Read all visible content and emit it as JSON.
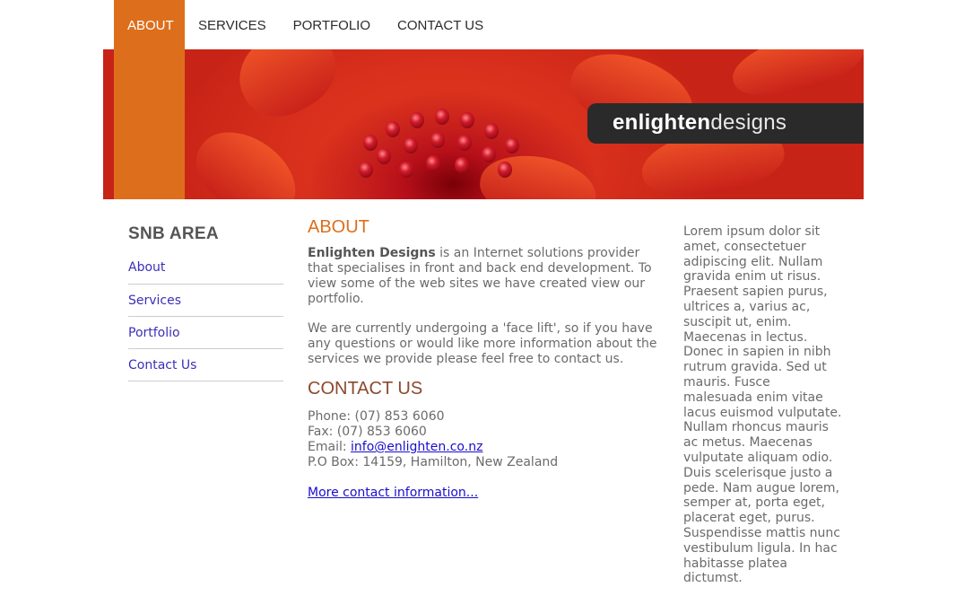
{
  "nav": {
    "items": [
      {
        "label": "ABOUT"
      },
      {
        "label": "SERVICES"
      },
      {
        "label": "PORTFOLIO"
      },
      {
        "label": "CONTACT US"
      }
    ]
  },
  "banner": {
    "logo_bold": "enlighten",
    "logo_light": "designs"
  },
  "sidebar": {
    "title": "SNB AREA",
    "items": [
      {
        "label": "About"
      },
      {
        "label": "Services"
      },
      {
        "label": "Portfolio"
      },
      {
        "label": "Contact Us"
      }
    ]
  },
  "main": {
    "about_heading": "ABOUT",
    "company": "Enlighten Designs",
    "intro_rest": " is an Internet solutions provider that specialises in front and back end development. To view some of the web sites we have created view our portfolio.",
    "para2": "We are currently undergoing a 'face lift', so if you have any questions or would like more information about the services we provide please feel free to contact us.",
    "contact_heading": "CONTACT US",
    "phone": "Phone: (07) 853 6060",
    "fax": "Fax: (07) 853 6060",
    "email_label": "Email: ",
    "email": "info@enlighten.co.nz",
    "pobox": "P.O Box: 14159, Hamilton, New Zealand",
    "more_link": "More contact information..."
  },
  "right": {
    "text": "Lorem ipsum dolor sit amet, consectetuer adipiscing elit. Nullam gravida enim ut risus. Praesent sapien purus, ultrices a, varius ac, suscipit ut, enim. Maecenas in lectus. Donec in sapien in nibh rutrum gravida. Sed ut mauris. Fusce malesuada enim vitae lacus euismod vulputate. Nullam rhoncus mauris ac metus. Maecenas vulputate aliquam odio. Duis scelerisque justo a pede. Nam augue lorem, semper at, porta eget, placerat eget, purus. Suspendisse mattis nunc vestibulum ligula. In hac habitasse platea dictumst."
  },
  "colors": {
    "accent": "#dd6f1c",
    "link": "#1a0dcc",
    "contact_heading": "#8b4a2d"
  }
}
